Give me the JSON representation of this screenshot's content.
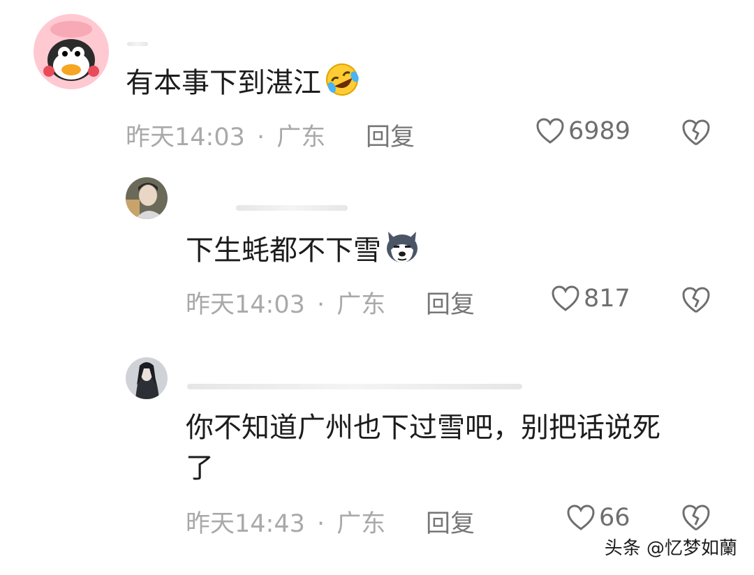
{
  "comments": [
    {
      "text": "有本事下到湛江",
      "emoji_icon": "rolling-laughing-emoji-icon",
      "time": "昨天14:03",
      "location": "广东",
      "reply_label": "回复",
      "likes": "6989"
    },
    {
      "text": "下生蚝都不下雪",
      "emoji_icon": "husky-dog-emoji-icon",
      "time": "昨天14:03",
      "location": "广东",
      "reply_label": "回复",
      "likes": "817"
    },
    {
      "text_line1": "你不知道广州也下过雪吧，别把话说死",
      "text_line2": "了",
      "time": "昨天14:43",
      "location": "广东",
      "reply_label": "回复",
      "likes": "66"
    }
  ],
  "separator": "·",
  "watermark": "头条 @忆梦如蘭",
  "colors": {
    "meta": "#a9a9a9",
    "reply": "#767676",
    "text": "#1c1c1c"
  }
}
